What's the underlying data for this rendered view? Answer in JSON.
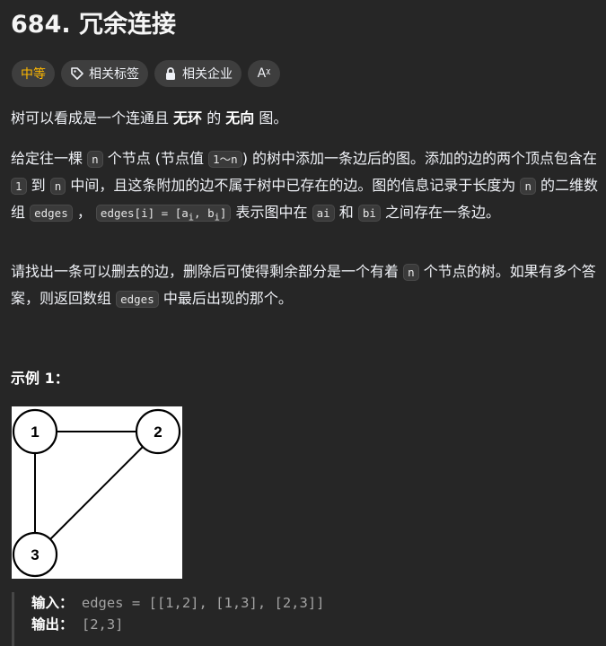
{
  "problem": {
    "title": "684. 冗余连接"
  },
  "tags": {
    "difficulty": "中等",
    "topics": "相关标签",
    "companies": "相关企业",
    "lang_icon": "Aᵡ"
  },
  "desc": {
    "p1_a": "树可以看成是一个连通且 ",
    "p1_b": "无环",
    "p1_c": " 的 ",
    "p1_d": "无向",
    "p1_e": " 图。",
    "p2_a": "给定往一棵 ",
    "code_n": "n",
    "p2_b": " 个节点 (节点值 ",
    "code_range": "1～n",
    "p2_c": ") 的树中添加一条边后的图。添加的边的两个顶点包含在 ",
    "code_1": "1",
    "p2_d": " 到 ",
    "p2_e": " 中间，且这条附加的边不属于树中已存在的边。图的信息记录于长度为 ",
    "p2_f": " 的二维数组 ",
    "code_edges": "edges",
    "p2_g": " ， ",
    "code_edges_i": "edges[i] = [a",
    "sub_i": "i",
    "code_edges_mid": ", b",
    "code_edges_end": "]",
    "p2_h": " 表示图中在 ",
    "code_ai": "ai",
    "p2_i": " 和 ",
    "code_bi": "bi",
    "p2_j": " 之间存在一条边。",
    "p3_a": "请找出一条可以删去的边，删除后可使得剩余部分是一个有着 ",
    "p3_b": " 个节点的树。如果有多个答案，则返回数组 ",
    "p3_c": " 中最后出现的那个。"
  },
  "example": {
    "title": "示例 1：",
    "nodes": [
      "1",
      "2",
      "3"
    ],
    "input_label": "输入：",
    "input_value": "edges = [[1,2], [1,3], [2,3]]",
    "output_label": "输出：",
    "output_value": "[2,3]"
  }
}
